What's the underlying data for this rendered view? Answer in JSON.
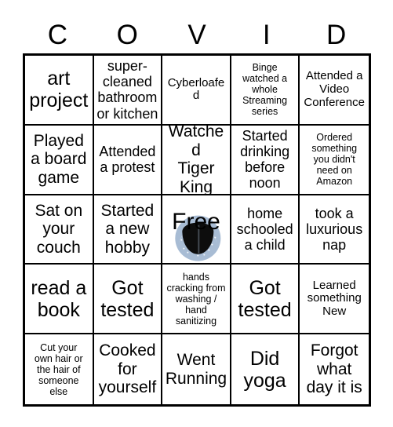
{
  "card": {
    "title_letters": [
      "C",
      "O",
      "V",
      "I",
      "D"
    ],
    "free_space_label": "Free",
    "colors": {
      "border": "#000000",
      "background": "#ffffff",
      "text": "#000000",
      "free_globe": "#a8bcd4",
      "free_globe_dark": "#0d0d0d"
    },
    "rows": [
      [
        {
          "text": "art\nproject",
          "size": "t-xl"
        },
        {
          "text": "super-\ncleaned\nbathroom\nor kitchen",
          "size": "t-md"
        },
        {
          "text": "Cyberloafed",
          "size": "t-sm"
        },
        {
          "text": "Binge\nwatched a\nwhole\nStreaming\nseries",
          "size": "t-xs"
        },
        {
          "text": "Attended a\nVideo\nConference",
          "size": "t-sm"
        }
      ],
      [
        {
          "text": "Played\na board\ngame",
          "size": "t-lg"
        },
        {
          "text": "Attended\na protest",
          "size": "t-md"
        },
        {
          "text": "Watched\nTiger\nKing",
          "size": "t-lg"
        },
        {
          "text": "Started\ndrinking\nbefore\nnoon",
          "size": "t-md"
        },
        {
          "text": "Ordered\nsomething\nyou didn't\nneed on\nAmazon",
          "size": "t-xs"
        }
      ],
      [
        {
          "text": "Sat on\nyour\ncouch",
          "size": "t-lg"
        },
        {
          "text": "Started\na new\nhobby",
          "size": "t-lg"
        },
        {
          "text": "Free",
          "size": "t-xl",
          "free": true
        },
        {
          "text": "home\nschooled\na child",
          "size": "t-md"
        },
        {
          "text": "took a\nluxurious\nnap",
          "size": "t-md"
        }
      ],
      [
        {
          "text": "read a\nbook",
          "size": "t-xl"
        },
        {
          "text": "Got\ntested",
          "size": "t-xl"
        },
        {
          "text": "hands\ncracking from\nwashing /\nhand\nsanitizing",
          "size": "t-xs"
        },
        {
          "text": "Got\ntested",
          "size": "t-xl"
        },
        {
          "text": "Learned\nsomething\nNew",
          "size": "t-sm"
        }
      ],
      [
        {
          "text": "Cut your\nown hair or\nthe hair of\nsomeone\nelse",
          "size": "t-xs"
        },
        {
          "text": "Cooked\nfor\nyourself",
          "size": "t-lg"
        },
        {
          "text": "Went\nRunning",
          "size": "t-lg"
        },
        {
          "text": "Did\nyoga",
          "size": "t-xl"
        },
        {
          "text": "Forgot\nwhat\nday it is",
          "size": "t-lg"
        }
      ]
    ]
  }
}
